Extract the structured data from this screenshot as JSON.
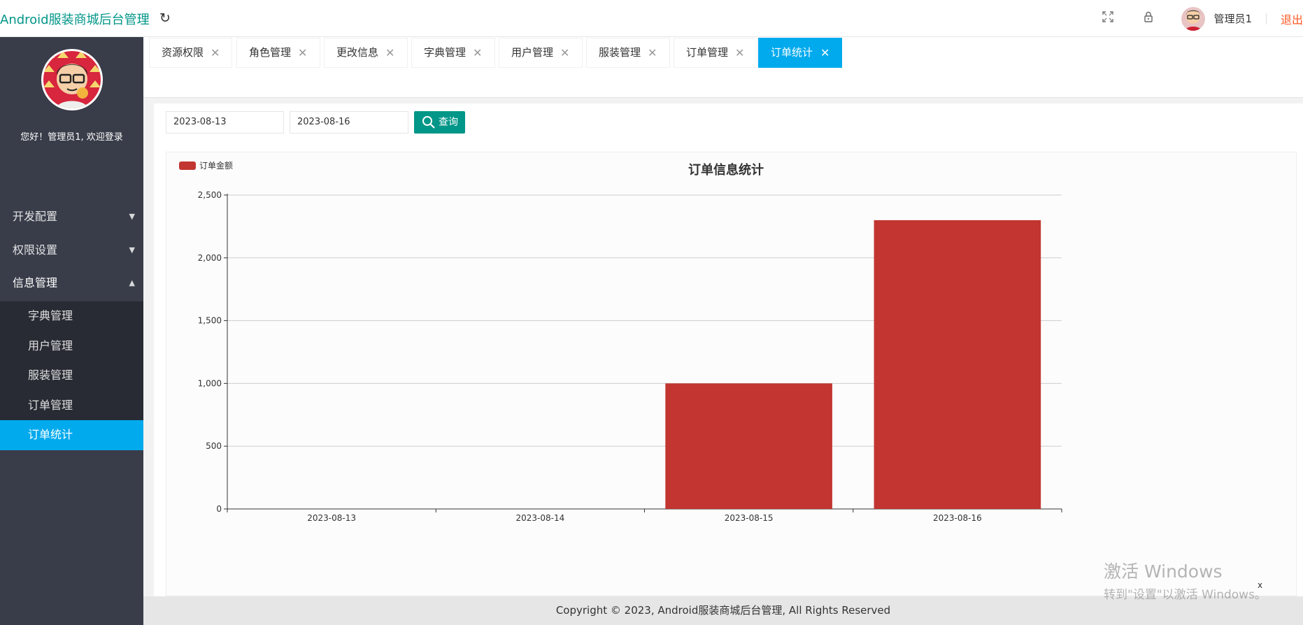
{
  "header": {
    "brand": "Android服装商城后台管理",
    "user_name": "管理员1",
    "logout": "退出",
    "icons": [
      "refresh-icon",
      "fullscreen-icon",
      "lock-icon"
    ]
  },
  "sidebar": {
    "greeting": "您好！管理员1, 欢迎登录",
    "groups": [
      {
        "label": "开发配置",
        "expanded": false
      },
      {
        "label": "权限设置",
        "expanded": false
      },
      {
        "label": "信息管理",
        "expanded": true
      }
    ],
    "sub_items": [
      {
        "label": "字典管理",
        "active": false
      },
      {
        "label": "用户管理",
        "active": false
      },
      {
        "label": "服装管理",
        "active": false
      },
      {
        "label": "订单管理",
        "active": false
      },
      {
        "label": "订单统计",
        "active": true
      }
    ]
  },
  "tabs": [
    {
      "label": "资源权限",
      "active": false
    },
    {
      "label": "角色管理",
      "active": false
    },
    {
      "label": "更改信息",
      "active": false
    },
    {
      "label": "字典管理",
      "active": false
    },
    {
      "label": "用户管理",
      "active": false
    },
    {
      "label": "服装管理",
      "active": false
    },
    {
      "label": "订单管理",
      "active": false
    },
    {
      "label": "订单统计",
      "active": true
    }
  ],
  "filter": {
    "start_date": "2023-08-13",
    "end_date": "2023-08-16",
    "query_label": "查询"
  },
  "chart_data": {
    "type": "bar",
    "title": "订单信息统计",
    "legend": [
      "订单金额"
    ],
    "legend_position": "top-left",
    "categories": [
      "2023-08-13",
      "2023-08-14",
      "2023-08-15",
      "2023-08-16"
    ],
    "series": [
      {
        "name": "订单金额",
        "values": [
          0,
          0,
          1000,
          2300
        ]
      }
    ],
    "ylim": [
      0,
      2500
    ],
    "yticks": [
      "0",
      "500",
      "1,000",
      "1,500",
      "2,000",
      "2,500"
    ],
    "xlabel": "x",
    "ylabel": "",
    "grid": true,
    "bar_color": "#c23531"
  },
  "footer": {
    "copyright": "Copyright © 2023, Android服装商城后台管理, All Rights Reserved"
  },
  "watermark": {
    "title": "激活 Windows",
    "subtitle": "转到\"设置\"以激活 Windows。"
  },
  "colors": {
    "accent": "#009688",
    "tab_active": "#01aaed",
    "sidebar_bg": "#393d49",
    "logout": "#ff5722"
  }
}
